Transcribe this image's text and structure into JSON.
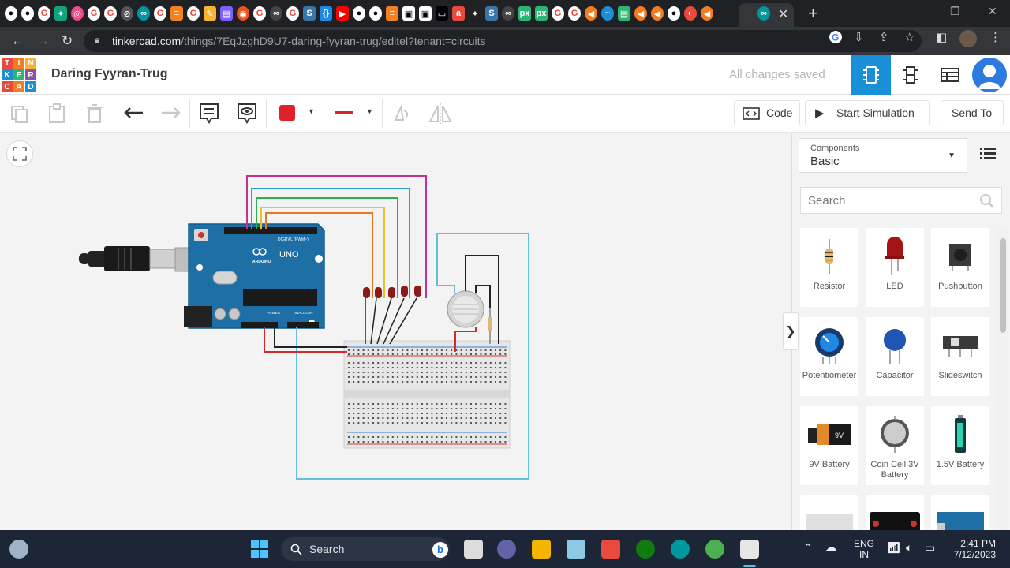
{
  "browser": {
    "url_host": "tinkercad.com",
    "url_path": "/things/7EqJzghD9U7-daring-fyyran-trug/editel?tenant=circuits"
  },
  "app": {
    "logo_letters": [
      "T",
      "I",
      "N",
      "K",
      "E",
      "R",
      "C",
      "A",
      "D"
    ],
    "logo_colors": [
      "#e84a3d",
      "#f37b21",
      "#f9b233",
      "#1a8fd8",
      "#2bb673",
      "#8c53a0",
      "#e84a3d",
      "#f37b21",
      "#1a8fd8"
    ],
    "design_name": "Daring Fyyran-Trug",
    "save_status": "All changes saved",
    "accent": "#1a8fd8"
  },
  "toolbar": {
    "code_label": "Code",
    "start_sim_label": "Start Simulation",
    "send_to_label": "Send To",
    "wire_color": "#e0202a"
  },
  "panel": {
    "select_label": "Components",
    "select_value": "Basic",
    "search_placeholder": "Search",
    "components": [
      {
        "label": "Resistor",
        "icon": "resistor-icon"
      },
      {
        "label": "LED",
        "icon": "led-icon"
      },
      {
        "label": "Pushbutton",
        "icon": "pushbutton-icon"
      },
      {
        "label": "Potentiometer",
        "icon": "potentiometer-icon"
      },
      {
        "label": "Capacitor",
        "icon": "capacitor-icon"
      },
      {
        "label": "Slideswitch",
        "icon": "slideswitch-icon"
      },
      {
        "label": "9V Battery",
        "icon": "9v-battery-icon"
      },
      {
        "label": "Coin Cell 3V Battery",
        "icon": "coin-cell-icon"
      },
      {
        "label": "1.5V Battery",
        "icon": "1.5v-battery-icon"
      },
      {
        "label": "",
        "icon": "breadboard-icon"
      },
      {
        "label": "",
        "icon": "microbit-icon"
      },
      {
        "label": "",
        "icon": "arduino-icon"
      }
    ]
  },
  "circuit": {
    "board_label": "UNO",
    "brand_label": "ARDUINO",
    "digital_label": "DIGITAL (PWM~)",
    "power_label": "POWER",
    "analog_label": "ANALOG IN",
    "battery_text": "9V"
  },
  "taskbar": {
    "search_label": "Search",
    "lang_line1": "ENG",
    "lang_line2": "IN",
    "time": "2:41 PM",
    "date": "7/12/2023"
  }
}
